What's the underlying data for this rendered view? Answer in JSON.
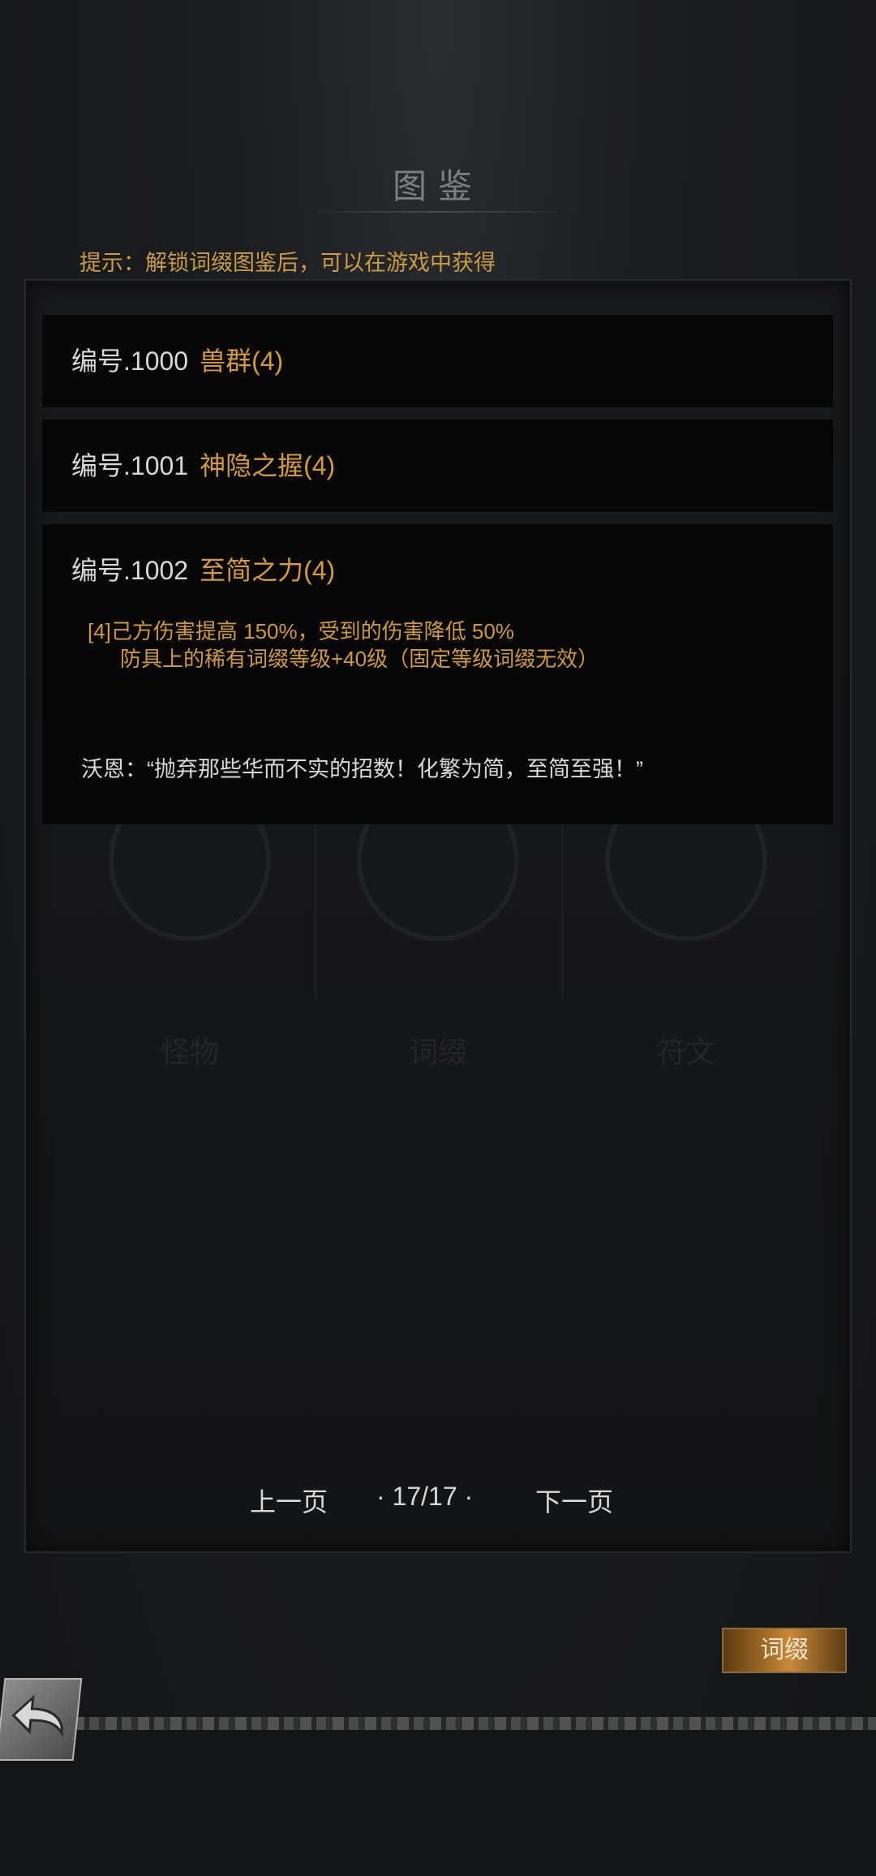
{
  "header": {
    "title": "图鉴"
  },
  "tip": "提示：解锁词缀图鉴后，可以在游戏中获得",
  "background_categories": [
    "怪物",
    "词缀",
    "符文"
  ],
  "entries": [
    {
      "id": "编号.1000",
      "name": "兽群(4)"
    },
    {
      "id": "编号.1001",
      "name": "神隐之握(4)"
    },
    {
      "id": "编号.1002",
      "name": "至简之力(4)",
      "effect_line1": "[4]己方伤害提高 150%，受到的伤害降低 50%",
      "effect_line2": "防具上的稀有词缀等级+40级（固定等级词缀无效）",
      "quote": "沃恩：“抛弃那些华而不实的招数！化繁为简，至简至强！”"
    }
  ],
  "pager": {
    "prev": "上一页",
    "indicator": "· 17/17 ·",
    "next": "下一页"
  },
  "bottom": {
    "tab_label": "词缀"
  },
  "icons": {
    "back": "back-arrow-icon"
  },
  "colors": {
    "accent": "#d39b3e",
    "text": "#d8d8d8",
    "background": "#141516"
  }
}
